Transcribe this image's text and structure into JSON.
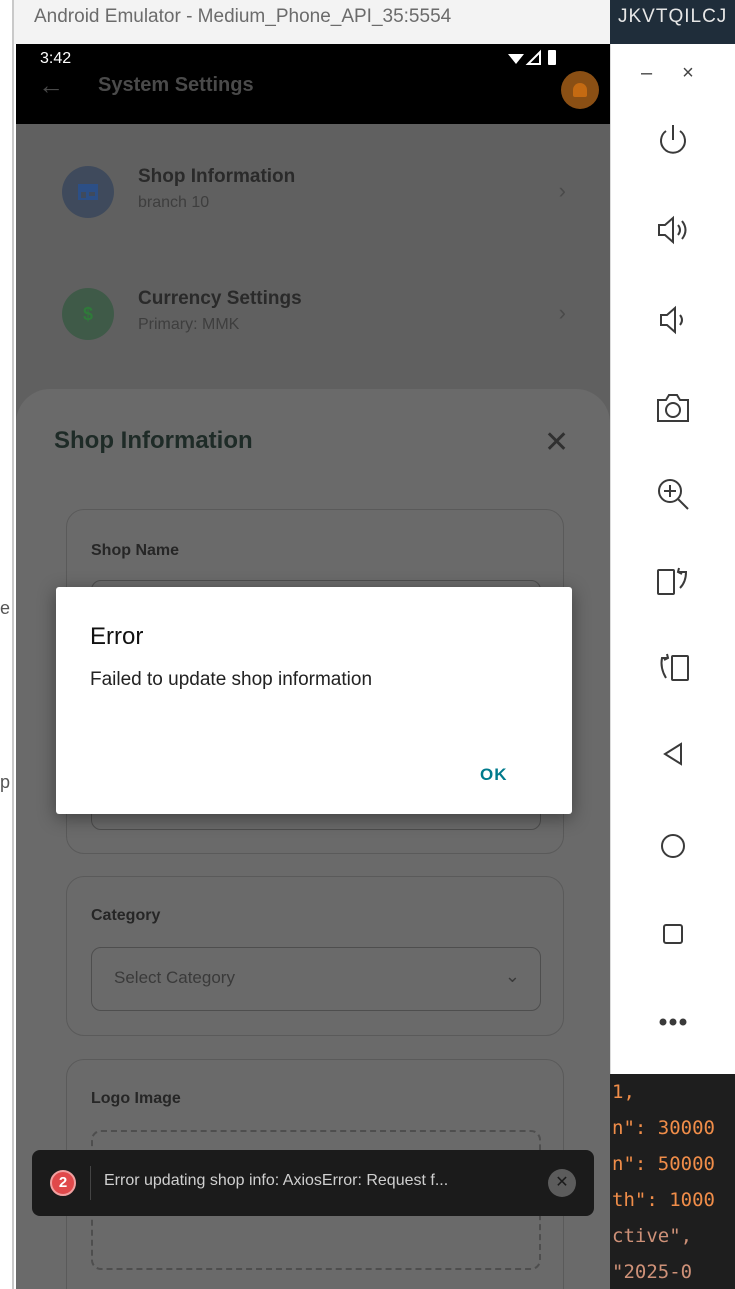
{
  "window": {
    "title": "Android Emulator - Medium_Phone_API_35:5554",
    "right_title": "JKVTQILCJ",
    "left_edge_chars": [
      "e",
      "p"
    ]
  },
  "toolbar": {
    "minimize": "–",
    "close": "×",
    "buttons": [
      {
        "name": "power-icon"
      },
      {
        "name": "volume-up-icon"
      },
      {
        "name": "volume-down-icon"
      },
      {
        "name": "camera-icon"
      },
      {
        "name": "zoom-in-icon"
      },
      {
        "name": "rotate-left-icon"
      },
      {
        "name": "rotate-right-icon"
      },
      {
        "name": "back-icon"
      },
      {
        "name": "home-icon"
      },
      {
        "name": "overview-icon"
      },
      {
        "name": "more-icon"
      }
    ]
  },
  "code_lines": [
    " 1,",
    "n\": 30000",
    "n\": 50000",
    "th\": 1000",
    "ctive\",",
    " \"2025-0"
  ],
  "phone": {
    "status": {
      "time": "3:42"
    },
    "appbar": {
      "title": "System Settings"
    },
    "cards": [
      {
        "title": "Shop Information",
        "subtitle": "branch 10",
        "icon": "store-icon",
        "icon_char": "▆",
        "icon_bg": "#3f4a5c",
        "icon_color": "#2c4f86"
      },
      {
        "title": "Currency Settings",
        "subtitle": "Primary: MMK",
        "icon": "dollar-icon",
        "icon_char": "$",
        "icon_bg": "#3f5a48",
        "icon_color": "#2f7a3a"
      }
    ],
    "sheet": {
      "title": "Shop Information",
      "shop_name_label": "Shop Name",
      "category_label": "Category",
      "category_placeholder": "Select Category",
      "logo_label": "Logo Image"
    },
    "dialog": {
      "title": "Error",
      "message": "Failed to update shop information",
      "ok": "OK"
    },
    "toast": {
      "count": "2",
      "text": "Error updating shop info: AxiosError: Request f..."
    }
  }
}
